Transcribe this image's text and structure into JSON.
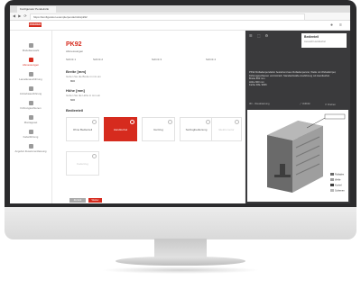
{
  "browser": {
    "tab_label": "Konfigurator Pendelrollo",
    "url": "https://konfigurator.example/pendelrollo/pk92",
    "nav_icons": "◀ ▶ ⟳"
  },
  "header": {
    "logo": "ROEDER"
  },
  "sidebar": {
    "items": [
      {
        "label": "Modellauswahl"
      },
      {
        "label": "Abmessungen"
      },
      {
        "label": "Lamellenausführung"
      },
      {
        "label": "Antriebsausführung"
      },
      {
        "label": "Führungsschienen"
      },
      {
        "label": "Montageset"
      },
      {
        "label": "Kabelführung"
      },
      {
        "label": "Angebot Zusammenfassung"
      }
    ]
  },
  "main": {
    "title": "PK92",
    "subtitle": "Abmessungen",
    "steps": [
      "Schritt 1",
      "Schritt 2",
      "Schritt 3",
      "Schritt 4"
    ],
    "width_section": "Breite [mm]",
    "width_hint": "Geben Sie die Breite in mm ein",
    "width_value": "800",
    "height_section": "Höhe [mm]",
    "height_hint": "Geben Sie die Höhe in mm ein",
    "height_value": "600",
    "drive_section": "Bedienteil",
    "cards": [
      {
        "label": "Ohne Bedienteil"
      },
      {
        "label": "Handkurbel"
      },
      {
        "label": "Gurtzug"
      },
      {
        "label": "Seilzugbedienung"
      },
      {
        "label": "Elektromotor"
      },
      {
        "label": "Federzug"
      }
    ],
    "back_label": "Zurück",
    "next_label": "Weiter"
  },
  "panel": {
    "tool_icons": "☰ ⬚ ⚙",
    "popup_title": "Bedienteil",
    "popup_subtitle": "Auswahl Handkurbel",
    "description": "PK92 Rolladenpendeltor bestehend aus Rolladenpanzer, Welle mit Wickelkörper, Führungsschienen und Antrieb. Standardmäße Ausführung mit Handkurbel.",
    "specs": [
      "Breite 800 mm",
      "Höhe 600 mm",
      "Farbe RAL 9006"
    ],
    "vis_label": "3D - Visualisierung",
    "vis_actions": [
      "⤢ Vollbild",
      "⟳ Drehen"
    ],
    "legend": [
      "Rolladen",
      "Welle",
      "Kurbel",
      "Schienen"
    ]
  },
  "colors": {
    "accent": "#d62b1e",
    "panel_bg": "#3a3a3c"
  }
}
